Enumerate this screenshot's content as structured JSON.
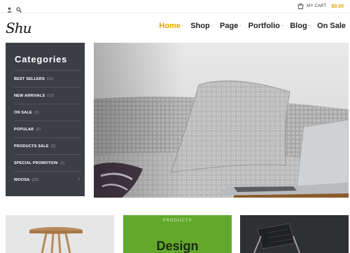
{
  "site": {
    "logo": "Shu"
  },
  "topbar": {
    "cart_label": "MY CART",
    "cart_price": "$0.00"
  },
  "nav": {
    "items": [
      {
        "label": "Home",
        "marker": "·"
      },
      {
        "label": "Shop",
        "marker": "·"
      },
      {
        "label": "Page",
        "marker": "·"
      },
      {
        "label": "Portfolio",
        "marker": "·"
      },
      {
        "label": "Blog",
        "marker": "·"
      },
      {
        "label": "On Sale",
        "marker": ""
      }
    ]
  },
  "categories": {
    "title": "Categories",
    "items": [
      {
        "name": "BEST SELLERS",
        "count": "(11)"
      },
      {
        "name": "NEW ARRIVALS",
        "count": "(13)"
      },
      {
        "name": "ON SALE",
        "count": "(2)"
      },
      {
        "name": "POPULAR",
        "count": "(6)"
      },
      {
        "name": "PRODUCTS SALE",
        "count": "(2)"
      },
      {
        "name": "SPECIAL PROMOTION",
        "count": "(1)"
      },
      {
        "name": "WOOSA",
        "count": "(22)"
      }
    ],
    "arrow": "›"
  },
  "banners": {
    "design": {
      "label": "PRODUCTS",
      "title": "Design"
    }
  },
  "colors": {
    "accent": "#e6a400",
    "sidebar": "#3b3e45",
    "green": "#62a82a"
  }
}
